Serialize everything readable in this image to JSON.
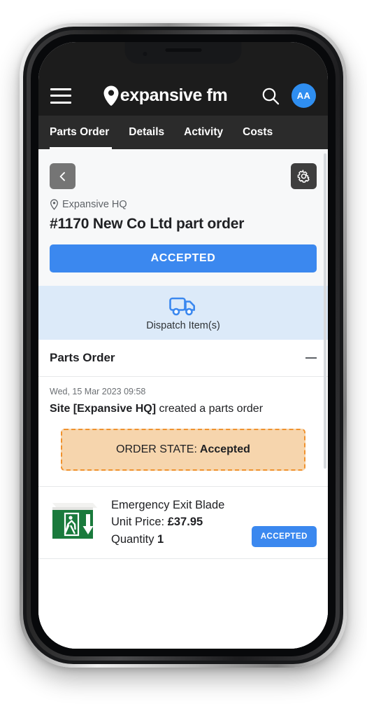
{
  "header": {
    "menu_icon": "hamburger-menu-icon",
    "brand_text": "expansive fm",
    "brand_pin_icon": "location-pin-logo-icon",
    "search_icon": "search-icon",
    "avatar_initials": "AA"
  },
  "tabs": [
    {
      "label": "Parts Order",
      "active": true
    },
    {
      "label": "Details",
      "active": false
    },
    {
      "label": "Activity",
      "active": false
    },
    {
      "label": "Costs",
      "active": false
    }
  ],
  "toolbar": {
    "back_icon": "chevron-left-icon",
    "settings_icon": "gear-icon"
  },
  "order": {
    "site_icon": "location-pin-icon",
    "site_name": "Expansive HQ",
    "title": "#1170 New Co Ltd part order",
    "status_label": "ACCEPTED"
  },
  "dispatch": {
    "icon": "delivery-truck-icon",
    "label": "Dispatch Item(s)"
  },
  "section": {
    "title": "Parts Order",
    "collapse_icon": "minus-icon"
  },
  "event": {
    "timestamp": "Wed, 15 Mar 2023 09:58",
    "actor": "Site [Expansive HQ]",
    "action": " created a parts order",
    "alert_label": "ORDER STATE:",
    "alert_value": "Accepted"
  },
  "item": {
    "thumb_icon": "emergency-exit-sign-icon",
    "name": "Emergency Exit Blade",
    "price_label": "Unit Price:",
    "price_value": "£37.95",
    "qty_label": "Quantity",
    "qty_value": "1",
    "badge": "ACCEPTED"
  },
  "colors": {
    "accent_blue": "#3b88ef",
    "header_dark": "#1c1c1c",
    "tabbar_dark": "#2b2b2b",
    "alert_fill": "#f6d5ad",
    "alert_border": "#f0922e",
    "dispatch_band": "#dceaf9"
  }
}
